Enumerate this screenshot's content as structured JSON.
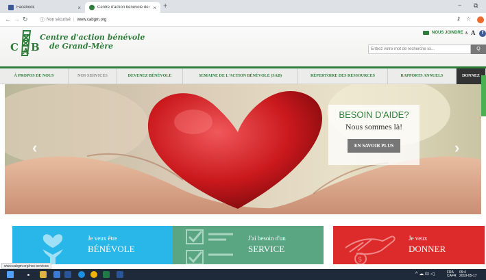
{
  "browser": {
    "tabs": [
      {
        "title": "Facebook",
        "active": false
      },
      {
        "title": "Centre d'action bénévole de Gra",
        "active": true
      }
    ],
    "new_tab_label": "+",
    "window_controls": [
      "−",
      "⧉"
    ],
    "security_label": "Non sécurisé",
    "url": "www.cabgm.org",
    "status_url": "www.cabgm.org/nos-services",
    "icons": [
      "back-arrow-icon",
      "forward-arrow-icon",
      "reload-icon",
      "info-icon",
      "key-icon",
      "star-icon",
      "extension-icon"
    ]
  },
  "site": {
    "logo_line1": "Centre d'action bénévole",
    "logo_line2": "de Grand-Mère",
    "join_label": "NOUS JOINDRE",
    "font_small": "A",
    "font_large": "A",
    "facebook_letter": "f",
    "search_placeholder": "Entrez votre mot de recherche ici...",
    "search_button": "Q",
    "brand_color": "#2e7d3a"
  },
  "nav": {
    "items": [
      {
        "label": "À PROPOS DE NOUS"
      },
      {
        "label": "NOS SERVICES"
      },
      {
        "label": "DEVENEZ BÉNÉVOLE"
      },
      {
        "label": "SEMAINE DE L'ACTION BÉNÉVOLE (SAB)"
      },
      {
        "label": "RÉPERTOIRE DES RESSOURCES"
      },
      {
        "label": "RAPPORTS ANNUELS"
      },
      {
        "label": "DONNEZ"
      }
    ]
  },
  "hero": {
    "title": "BESOIN D'AIDE?",
    "subtitle": "Nous sommes là!",
    "button": "EN SAVOIR PLUS",
    "prev_arrow": "‹",
    "next_arrow": "›"
  },
  "cards": [
    {
      "small": "Je veux être",
      "big": "BÉNÉVOLE",
      "color": "#29b6e8"
    },
    {
      "small": "J'ai besoin d'un",
      "big": "SERVICE",
      "color": "#5aa582"
    },
    {
      "small": "Je veux",
      "big": "DONNER",
      "color": "#dd2b2b"
    }
  ],
  "taskbar": {
    "language": "FRA",
    "region": "CAFR",
    "time": "09:4",
    "date": "2019-05-17"
  }
}
